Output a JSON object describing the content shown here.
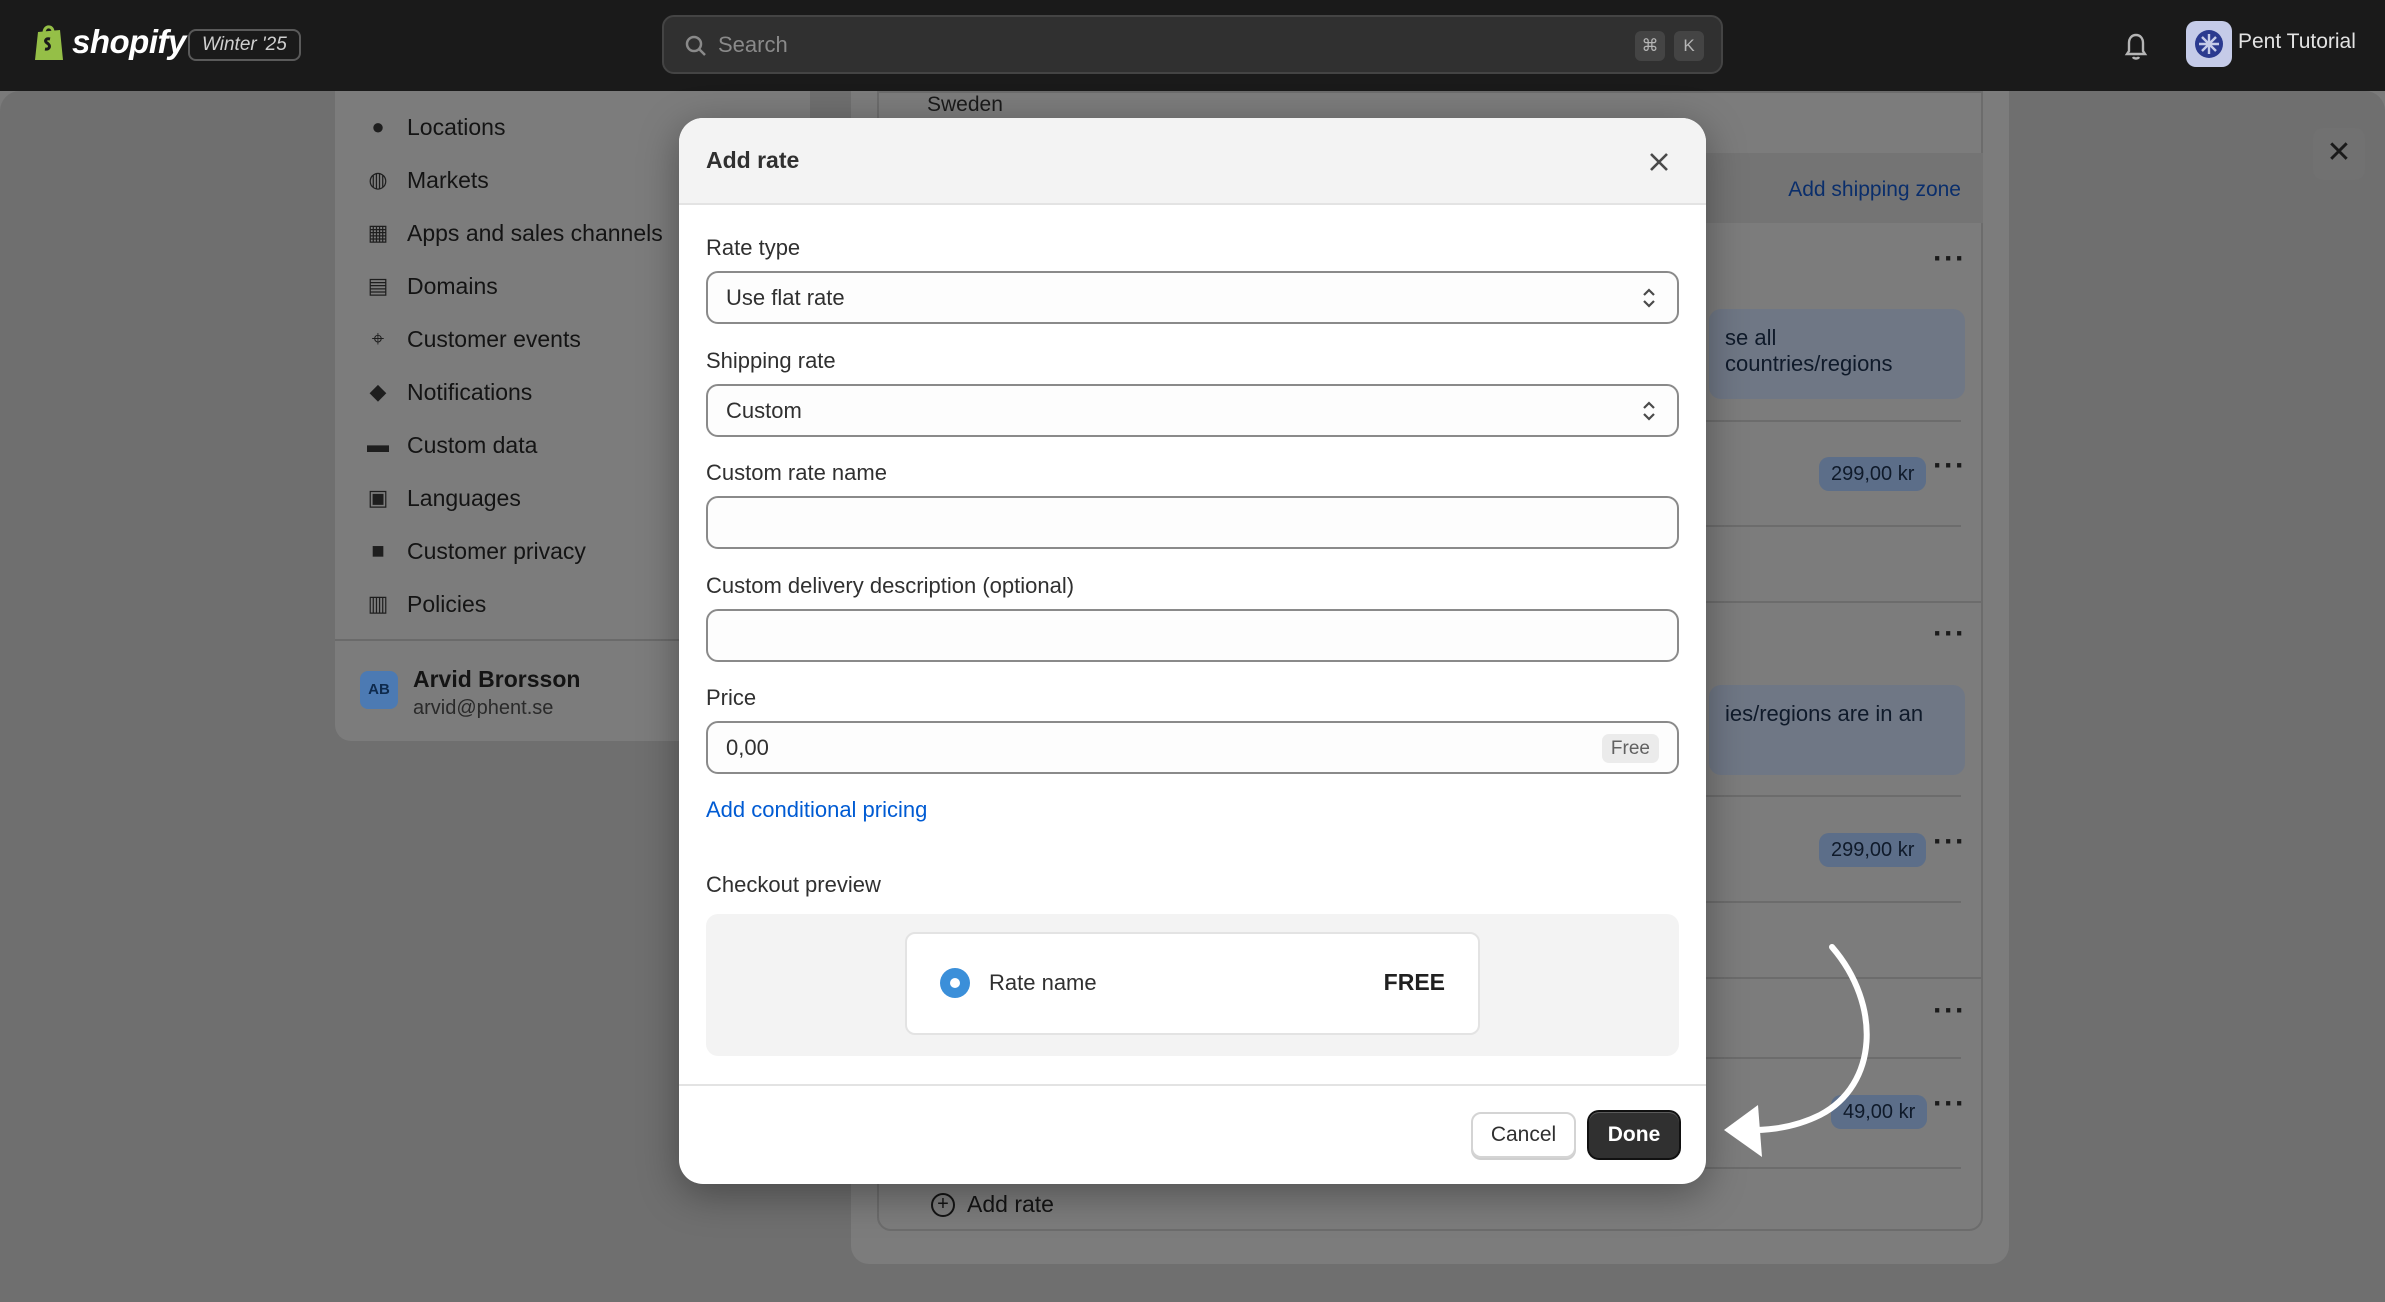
{
  "topbar": {
    "brand": "shopify",
    "release": "Winter '25",
    "search_placeholder": "Search",
    "shortcut_keys": [
      "⌘",
      "K"
    ],
    "store_name": "Pent Tutorial"
  },
  "sidebar": {
    "items": [
      {
        "label": "Locations",
        "icon": "location-pin-icon"
      },
      {
        "label": "Markets",
        "icon": "globe-icon"
      },
      {
        "label": "Apps and sales channels",
        "icon": "apps-icon"
      },
      {
        "label": "Domains",
        "icon": "domain-icon"
      },
      {
        "label": "Customer events",
        "icon": "cursor-click-icon"
      },
      {
        "label": "Notifications",
        "icon": "bell-icon"
      },
      {
        "label": "Custom data",
        "icon": "database-icon"
      },
      {
        "label": "Languages",
        "icon": "language-icon"
      },
      {
        "label": "Customer privacy",
        "icon": "lock-icon"
      },
      {
        "label": "Policies",
        "icon": "policy-icon"
      }
    ],
    "user": {
      "initials": "AB",
      "name": "Arvid Brorsson",
      "email": "arvid@phent.se"
    }
  },
  "background": {
    "zone_country": "Sweden",
    "add_shipping_zone": "Add shipping zone",
    "info_1": "se all countries/regions",
    "info_2": "ies/regions are in an",
    "price_1": "299,00 kr",
    "price_2": "299,00 kr",
    "price_3": "49,00 kr",
    "add_rate": "Add rate"
  },
  "modal": {
    "title": "Add rate",
    "rate_type_label": "Rate type",
    "rate_type_value": "Use flat rate",
    "shipping_rate_label": "Shipping rate",
    "shipping_rate_value": "Custom",
    "custom_name_label": "Custom rate name",
    "custom_name_value": "",
    "delivery_desc_label": "Custom delivery description (optional)",
    "delivery_desc_value": "",
    "price_label": "Price",
    "price_value": "0,00",
    "price_tag": "Free",
    "conditional_link": "Add conditional pricing",
    "preview_label": "Checkout preview",
    "preview_rate_name": "Rate name",
    "preview_rate_price": "FREE",
    "cancel_label": "Cancel",
    "done_label": "Done"
  },
  "colors": {
    "accent_link": "#005bd3",
    "primary_button": "#303030",
    "radio": "#3b8fd9"
  }
}
